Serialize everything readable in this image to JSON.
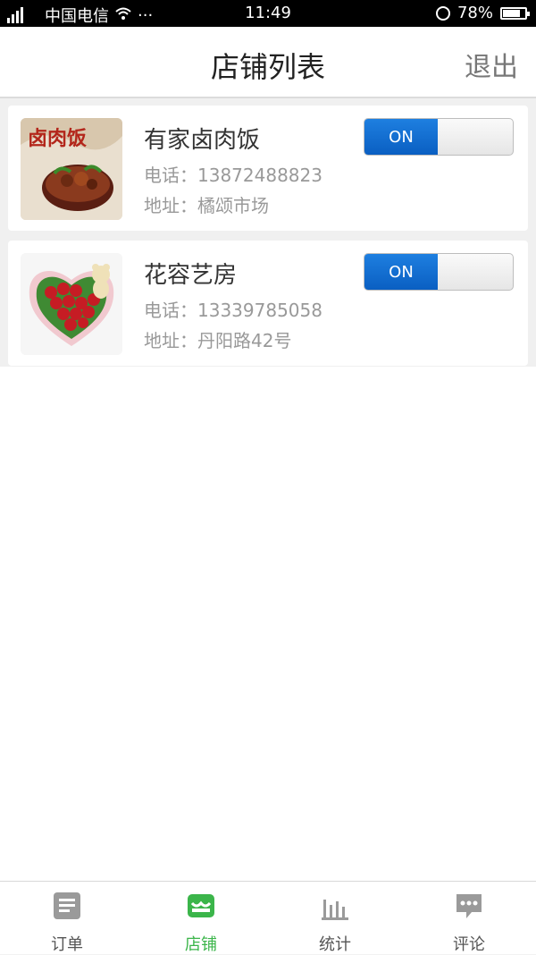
{
  "status_bar": {
    "carrier": "中国电信",
    "more": "···",
    "time": "11:49",
    "battery": "78%",
    "battery_level": 0.78
  },
  "header": {
    "title": "店铺列表",
    "logout": "退出"
  },
  "stores": [
    {
      "name": "有家卤肉饭",
      "phone": "电话：13872488823",
      "address": "地址：橘颂市场",
      "toggle": "ON",
      "thumb_text": "卤肉饭",
      "thumb_icon": "braised-pork-rice-photo"
    },
    {
      "name": "花容艺房",
      "phone": "电话：13339785058",
      "address": "地址：丹阳路42号",
      "toggle": "ON",
      "thumb_icon": "heart-rose-bouquet-photo"
    }
  ],
  "bottom_nav": {
    "tabs": [
      {
        "label": "订单",
        "icon": "order-icon",
        "active": false
      },
      {
        "label": "店铺",
        "icon": "store-icon",
        "active": true
      },
      {
        "label": "统计",
        "icon": "stats-icon",
        "active": false
      },
      {
        "label": "评论",
        "icon": "comment-icon",
        "active": false
      }
    ]
  },
  "colors": {
    "accent_active": "#3bb54a",
    "toggle_on": "#0a5fc2",
    "inactive_icon": "#9a9a9a"
  }
}
